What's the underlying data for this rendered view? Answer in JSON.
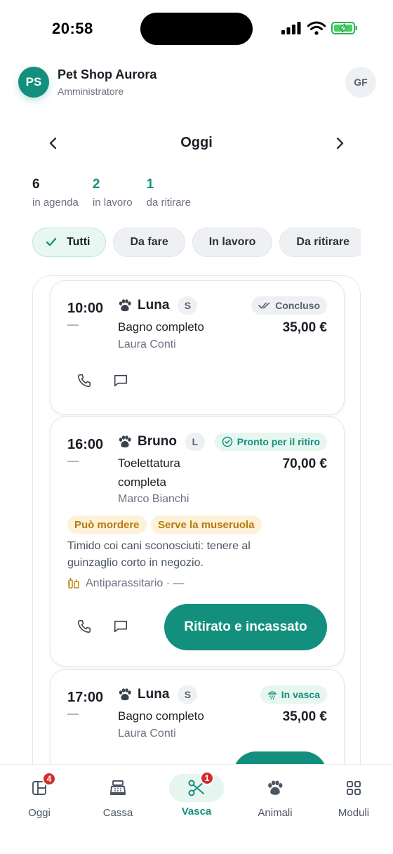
{
  "status_bar": {
    "time": "20:58"
  },
  "header": {
    "avatar_initials": "PS",
    "shop_name": "Pet Shop Aurora",
    "role": "Amministratore",
    "user_initials": "GF"
  },
  "day_nav": {
    "title": "Oggi"
  },
  "stats": [
    {
      "value": "6",
      "label": "in agenda"
    },
    {
      "value": "2",
      "label": "in lavoro"
    },
    {
      "value": "1",
      "label": "da ritirare"
    }
  ],
  "filters": [
    {
      "label": "Tutti",
      "active": true
    },
    {
      "label": "Da fare"
    },
    {
      "label": "In lavoro"
    },
    {
      "label": "Da ritirare"
    }
  ],
  "appointments": [
    {
      "time": "10:00",
      "end": "—",
      "pet": "Luna",
      "size": "S",
      "status": "Concluso",
      "service": "Bagno completo",
      "owner": "Laura Conti",
      "price": "35,00 €"
    },
    {
      "time": "16:00",
      "end": "—",
      "pet": "Bruno",
      "size": "L",
      "status": "Pronto per il ritiro",
      "service_line1": "Toelettatura",
      "service_line2": "completa",
      "owner": "Marco Bianchi",
      "price": "70,00 €",
      "tags": [
        "Può mordere",
        "Serve la museruola"
      ],
      "note_line1": "Timido coi cani sconosciuti: tenere al",
      "note_line2": "guinzaglio corto in negozio.",
      "treatment": "Antiparassitario · —",
      "action": "Ritirato e incassato"
    },
    {
      "time": "17:00",
      "end": "—",
      "pet": "Luna",
      "size": "S",
      "status": "In vasca",
      "service": "Bagno completo",
      "owner": "Laura Conti",
      "price": "35,00 €"
    }
  ],
  "tabbar": [
    {
      "label": "Oggi",
      "badge": "4"
    },
    {
      "label": "Cassa"
    },
    {
      "label": "Vasca",
      "badge": "1",
      "active": true
    },
    {
      "label": "Animali"
    },
    {
      "label": "Moduli"
    }
  ],
  "colors": {
    "accent": "#13907d",
    "badge": "#d12e2e",
    "warning_tag_bg": "#fdf1d8",
    "warning_tag_text": "#b7790e"
  }
}
